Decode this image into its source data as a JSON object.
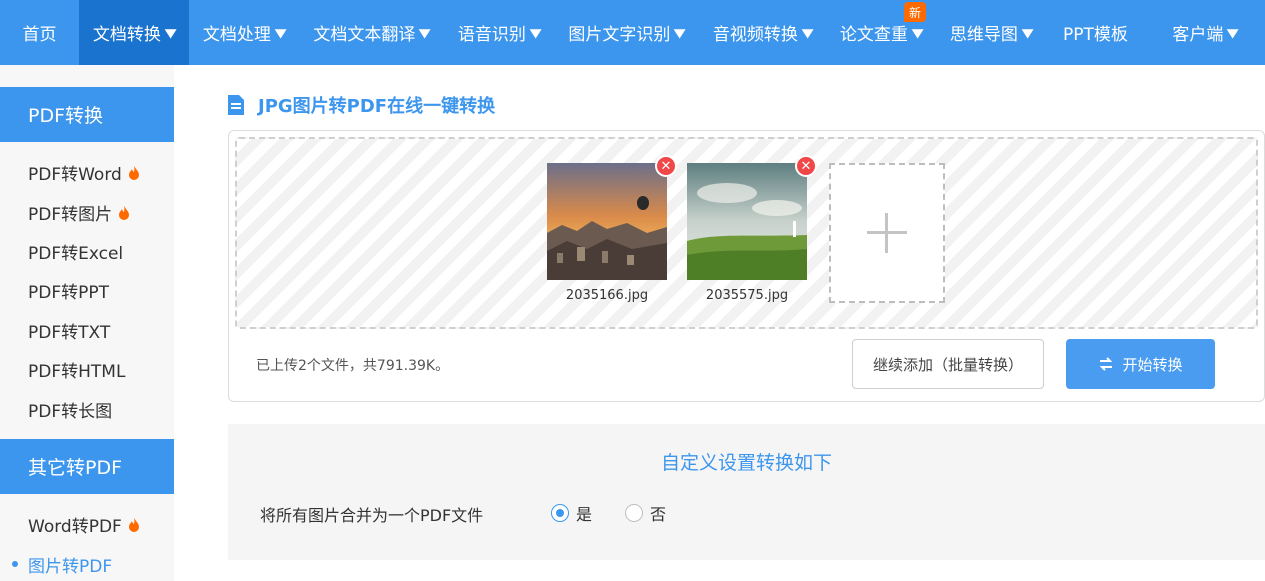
{
  "nav": {
    "items": [
      {
        "label": "首页",
        "caret": false
      },
      {
        "label": "文档转换",
        "caret": true,
        "active": true
      },
      {
        "label": "文档处理",
        "caret": true
      },
      {
        "label": "文档文本翻译",
        "caret": true
      },
      {
        "label": "语音识别",
        "caret": true
      },
      {
        "label": "图片文字识别",
        "caret": true
      },
      {
        "label": "音视频转换",
        "caret": true
      },
      {
        "label": "论文查重",
        "caret": true,
        "badge": "新"
      },
      {
        "label": "思维导图",
        "caret": true
      },
      {
        "label": "PPT模板",
        "caret": false
      },
      {
        "label": "客户端",
        "caret": true
      }
    ]
  },
  "sidebar": {
    "groups": [
      {
        "title": "PDF转换",
        "items": [
          {
            "label": "PDF转Word",
            "hot": true
          },
          {
            "label": "PDF转图片",
            "hot": true
          },
          {
            "label": "PDF转Excel",
            "hot": false
          },
          {
            "label": "PDF转PPT",
            "hot": false
          },
          {
            "label": "PDF转TXT",
            "hot": false
          },
          {
            "label": "PDF转HTML",
            "hot": false
          },
          {
            "label": "PDF转长图",
            "hot": false
          }
        ]
      },
      {
        "title": "其它转PDF",
        "items": [
          {
            "label": "Word转PDF",
            "hot": true
          },
          {
            "label": "图片转PDF",
            "hot": false,
            "current": true
          }
        ]
      }
    ]
  },
  "page": {
    "title": "JPG图片转PDF在线一键转换"
  },
  "upload": {
    "files": [
      {
        "name": "2035166.jpg",
        "remove_icon": "close-icon"
      },
      {
        "name": "2035575.jpg",
        "remove_icon": "close-icon"
      }
    ],
    "info": "已上传2个文件，共791.39K。",
    "continue_label": "继续添加（批量转换）",
    "start_label": "开始转换"
  },
  "settings": {
    "title": "自定义设置转换如下",
    "merge_label": "将所有图片合并为一个PDF文件",
    "options": [
      {
        "label": "是",
        "checked": true
      },
      {
        "label": "否",
        "checked": false
      }
    ]
  },
  "colors": {
    "brand": "#3d96ee",
    "nav_active": "#1a73cf",
    "badge": "#ff6a00",
    "remove": "#f04848",
    "hot": "#ff6a00"
  }
}
